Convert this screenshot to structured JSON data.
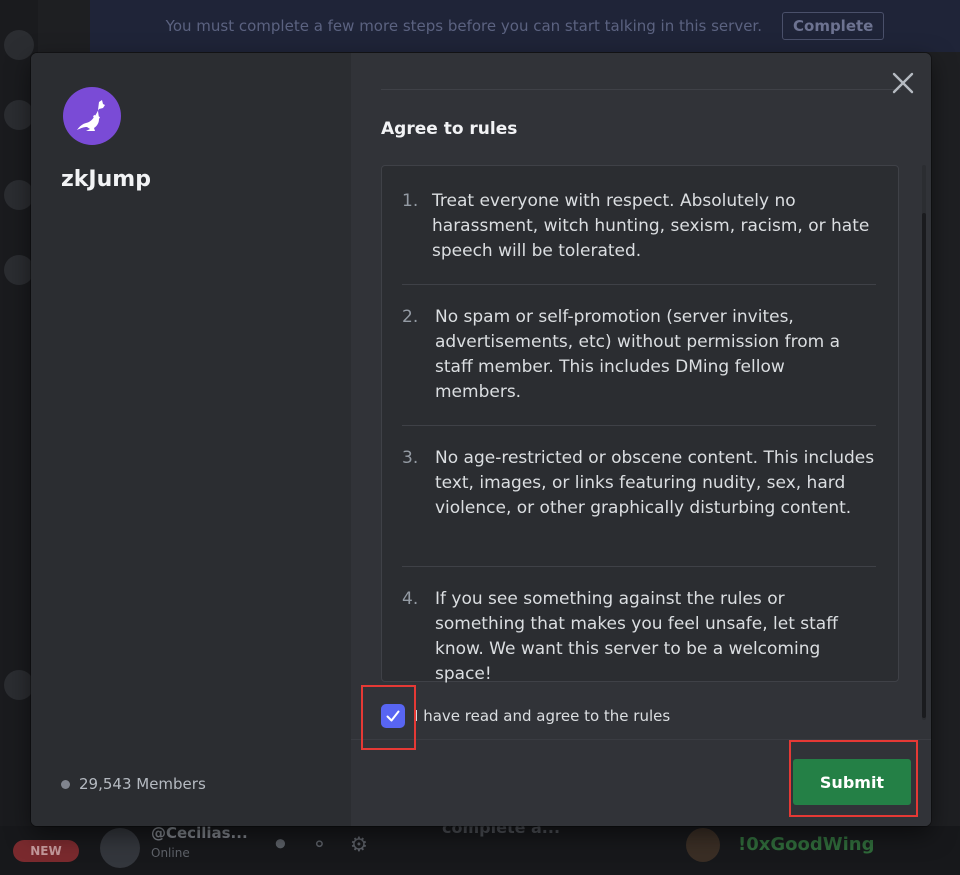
{
  "background": {
    "notice_text": "You must complete a few more steps before you can start talking in this server.",
    "notice_button": "Complete",
    "new_badge": "NEW",
    "user_name": "@Cecilias...",
    "user_status": "Online",
    "complete_text": "complete a...",
    "member_name": "!0xGoodWing"
  },
  "modal": {
    "server_name": "zkJump",
    "member_count": "29,543 Members",
    "section_title": "Agree to rules",
    "rules": [
      {
        "num": "1.",
        "text": "Treat everyone with respect. Absolutely no harassment, witch hunting, sexism, racism, or hate speech will be tolerated."
      },
      {
        "num": "2.",
        "text": "No spam or self-promotion (server invites, advertisements, etc) without permission from a staff member. This includes DMing fellow members."
      },
      {
        "num": "3.",
        "text": "No age-restricted or obscene content. This includes text, images, or links featuring nudity, sex, hard violence, or other graphically disturbing content."
      },
      {
        "num": "4.",
        "text": "If you see something against the rules or something that makes you feel unsafe, let staff know. We want this server to be a welcoming space!"
      }
    ],
    "agree_label": "I have read and agree to the rules",
    "agree_checked": true,
    "submit_label": "Submit"
  },
  "colors": {
    "accent": "#5865f2",
    "submit": "#248046",
    "server_icon": "#7a4bd6",
    "annotation": "#e53935"
  }
}
